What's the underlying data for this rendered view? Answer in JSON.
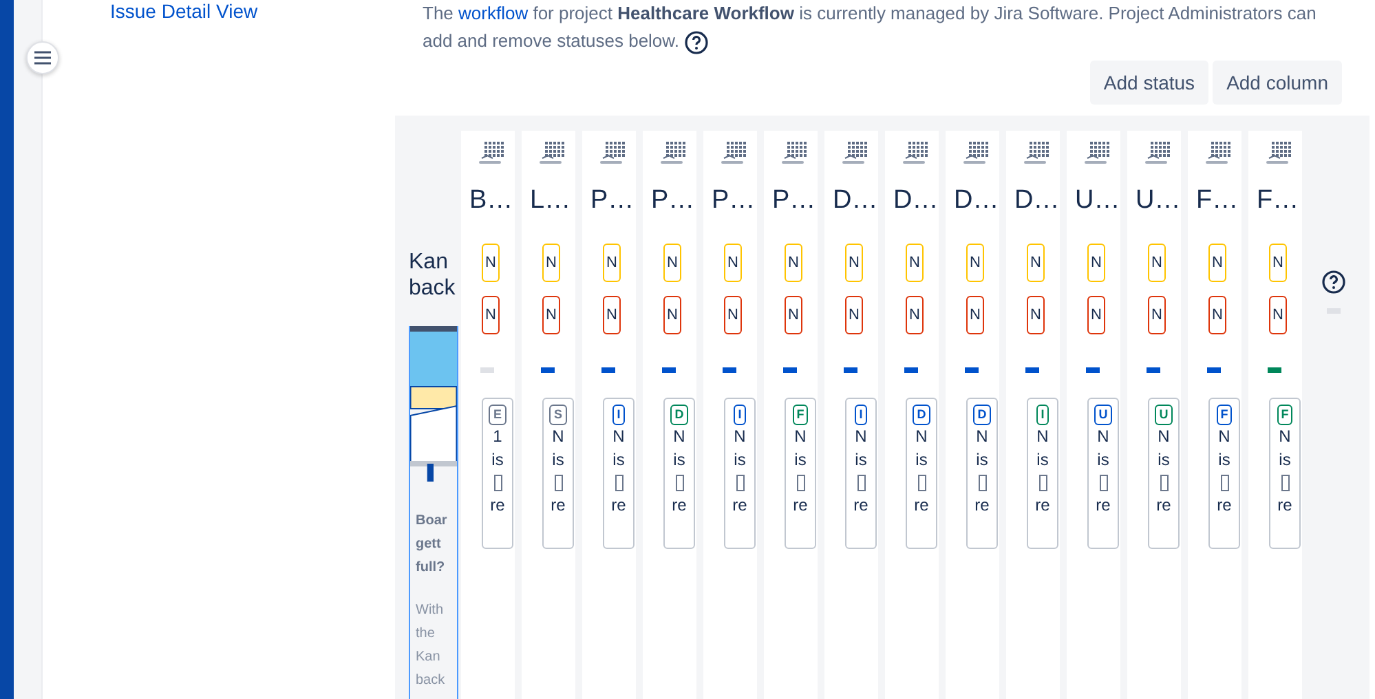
{
  "sidebar": {
    "link": "Issue Detail View"
  },
  "intro": {
    "prefix": "The ",
    "link": "workflow",
    "rest": " for project **Healthcare Workflow** is currently managed by Jira Software. Project Administrators can add and remove statuses below."
  },
  "buttons": [
    "Add status",
    "Add column"
  ],
  "promo": {
    "title_lines": [
      "Kan",
      "back"
    ],
    "heading": "Boar gett full?",
    "body": "With the Kan back"
  },
  "columns": [
    {
      "title": "B…",
      "min": "N",
      "max": "N",
      "color": "#dfe1e6",
      "card": {
        "lozenge": "E",
        "color": "#6b778c",
        "count": "1",
        "text": "is",
        "footer": "re"
      }
    },
    {
      "title": "L…",
      "min": "N",
      "max": "N",
      "color": "#0052cc",
      "card": {
        "lozenge": "S",
        "color": "#6b778c",
        "count": "N",
        "text": "is",
        "footer": "re"
      }
    },
    {
      "title": "P…",
      "min": "N",
      "max": "N",
      "color": "#0052cc",
      "card": {
        "lozenge": "I",
        "color": "#0052cc",
        "count": "N",
        "text": "is",
        "footer": "re"
      }
    },
    {
      "title": "P…",
      "min": "N",
      "max": "N",
      "color": "#0052cc",
      "card": {
        "lozenge": "D",
        "color": "#00875a",
        "count": "N",
        "text": "is",
        "footer": "re"
      }
    },
    {
      "title": "P…",
      "min": "N",
      "max": "N",
      "color": "#0052cc",
      "card": {
        "lozenge": "I",
        "color": "#0052cc",
        "count": "N",
        "text": "is",
        "footer": "re"
      }
    },
    {
      "title": "P…",
      "min": "N",
      "max": "N",
      "color": "#0052cc",
      "card": {
        "lozenge": "F",
        "color": "#00875a",
        "count": "N",
        "text": "is",
        "footer": "re"
      }
    },
    {
      "title": "D…",
      "min": "N",
      "max": "N",
      "color": "#0052cc",
      "card": {
        "lozenge": "I",
        "color": "#0052cc",
        "count": "N",
        "text": "is",
        "footer": "re"
      }
    },
    {
      "title": "D…",
      "min": "N",
      "max": "N",
      "color": "#0052cc",
      "card": {
        "lozenge": "D",
        "color": "#0052cc",
        "count": "N",
        "text": "is",
        "footer": "re"
      }
    },
    {
      "title": "D…",
      "min": "N",
      "max": "N",
      "color": "#0052cc",
      "card": {
        "lozenge": "D",
        "color": "#0052cc",
        "count": "N",
        "text": "is",
        "footer": "re"
      }
    },
    {
      "title": "D…",
      "min": "N",
      "max": "N",
      "color": "#0052cc",
      "card": {
        "lozenge": "I",
        "color": "#00875a",
        "count": "N",
        "text": "is",
        "footer": "re"
      }
    },
    {
      "title": "U…",
      "min": "N",
      "max": "N",
      "color": "#0052cc",
      "card": {
        "lozenge": "U",
        "color": "#0052cc",
        "count": "N",
        "text": "is",
        "footer": "re"
      }
    },
    {
      "title": "U…",
      "min": "N",
      "max": "N",
      "color": "#0052cc",
      "card": {
        "lozenge": "U",
        "color": "#00875a",
        "count": "N",
        "text": "is",
        "footer": "re"
      }
    },
    {
      "title": "F…",
      "min": "N",
      "max": "N",
      "color": "#0052cc",
      "card": {
        "lozenge": "F",
        "color": "#0052cc",
        "count": "N",
        "text": "is",
        "footer": "re"
      }
    },
    {
      "title": "F…",
      "min": "N",
      "max": "N",
      "color": "#00875a",
      "card": {
        "lozenge": "F",
        "color": "#00875a",
        "count": "N",
        "text": "is",
        "footer": "re"
      }
    }
  ]
}
